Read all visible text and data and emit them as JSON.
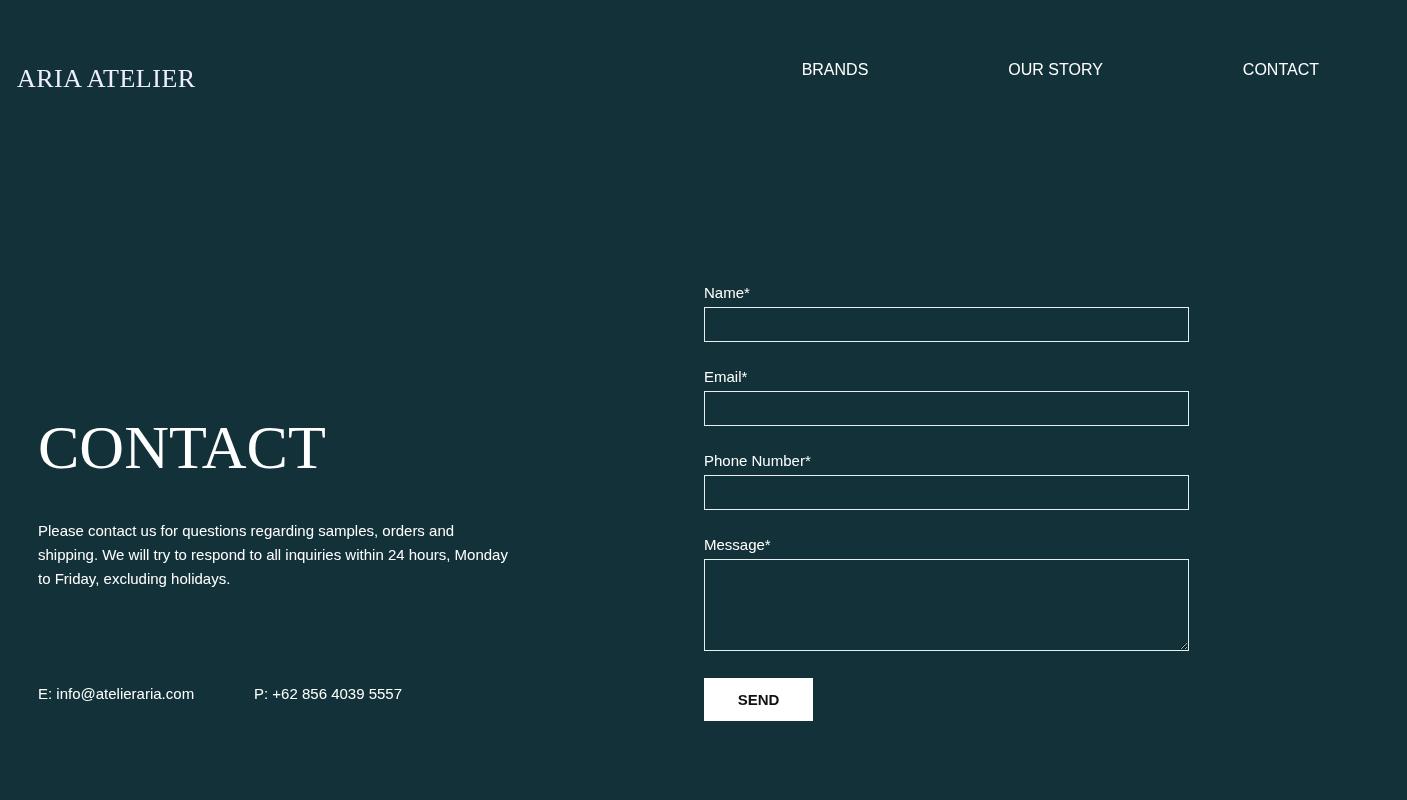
{
  "logo": "ARIA ATELIER",
  "nav": [
    {
      "label": "BRANDS"
    },
    {
      "label": "OUR STORY"
    },
    {
      "label": "CONTACT"
    }
  ],
  "heading": "CONTACT",
  "intro": "Please contact us for questions regarding samples, orders and shipping. We will try to respond to all inquiries within 24 hours, Monday to Friday, excluding holidays.",
  "contacts": [
    "E: info@atelieraria.com",
    "P: +62 856 4039 5557"
  ],
  "form": {
    "fields": [
      {
        "label": "Name*",
        "kind": "input"
      },
      {
        "label": "Email*",
        "kind": "input"
      },
      {
        "label": "Phone Number*",
        "kind": "input"
      },
      {
        "label": "Message*",
        "kind": "textarea"
      }
    ],
    "submit": "SEND"
  }
}
